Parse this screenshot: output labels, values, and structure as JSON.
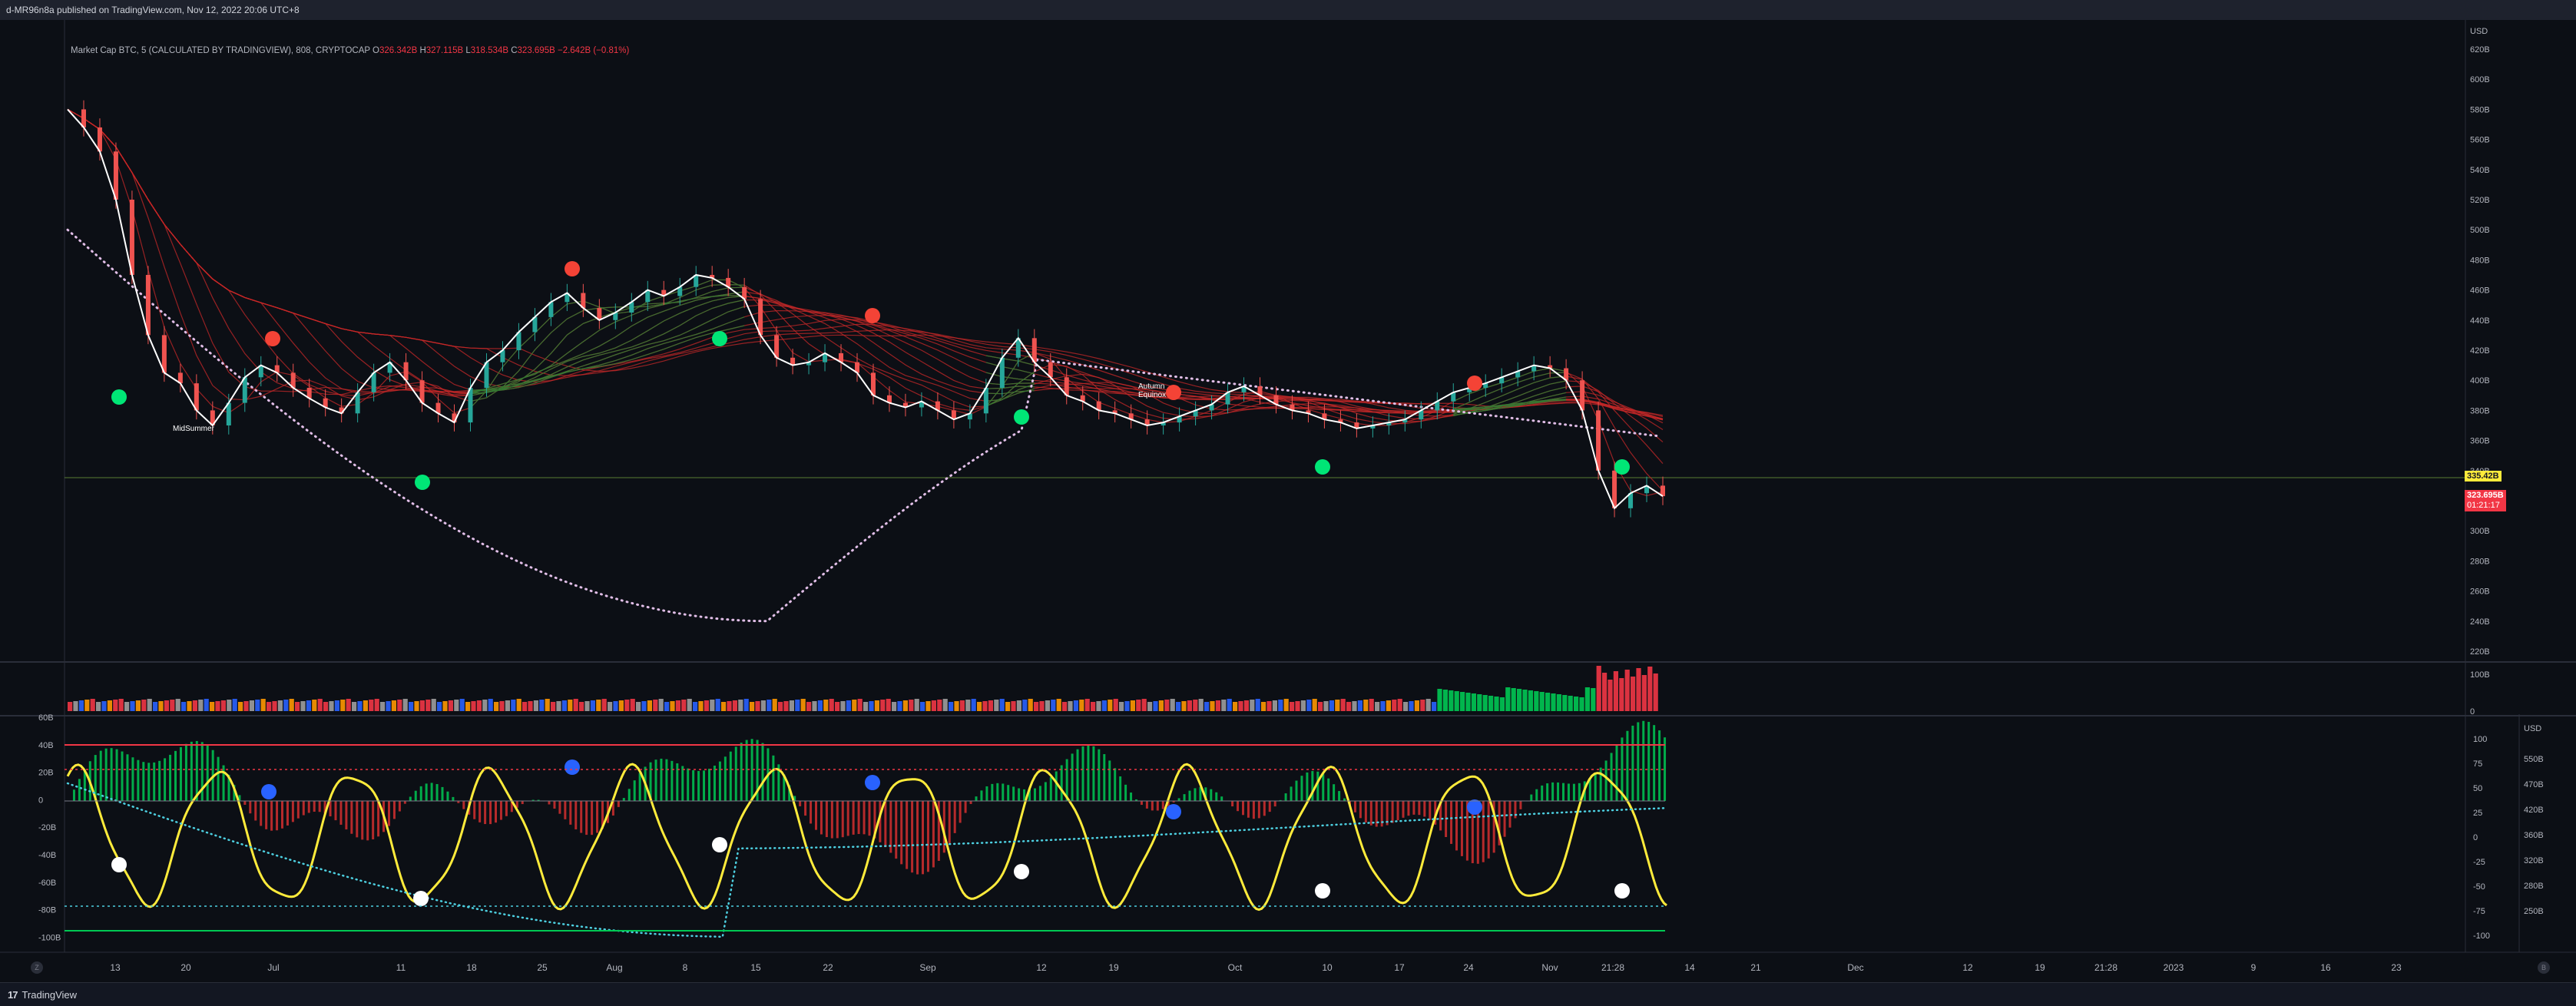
{
  "header": {
    "publish_text": "d-MR96n8a published on TradingView.com, Nov 12, 2022 20:06 UTC+8"
  },
  "legend": {
    "symbol": "Market Cap BTC, 5 (CALCULATED BY TRADINGVIEW), 808, CRYPTOCAP",
    "o_label": "O",
    "o_value": "326.342B",
    "h_label": "H",
    "h_value": "327.115B",
    "l_label": "L",
    "l_value": "318.534B",
    "c_label": "C",
    "c_value": "323.695B",
    "change": "−2.642B (−0.81%)"
  },
  "price_axis": {
    "currency": "USD",
    "ticks": [
      "620B",
      "600B",
      "580B",
      "560B",
      "540B",
      "520B",
      "500B",
      "480B",
      "460B",
      "440B",
      "420B",
      "400B",
      "380B",
      "360B",
      "340B",
      "300B",
      "280B",
      "260B",
      "240B",
      "220B"
    ],
    "hline_label": "335.42B",
    "last_price": "323.695B",
    "countdown": "01:21:17"
  },
  "volume_axis": {
    "ticks": [
      "100B",
      "0"
    ]
  },
  "osc_left_axis": {
    "ticks": [
      "60B",
      "40B",
      "20B",
      "0",
      "-20B",
      "-40B",
      "-60B",
      "-80B",
      "-100B"
    ]
  },
  "osc_right_axis": {
    "currency": "USD",
    "ticks_a": [
      "100",
      "75",
      "50",
      "25",
      "0",
      "-25",
      "-50",
      "-75",
      "-100"
    ],
    "ticks_b": [
      "550B",
      "470B",
      "420B",
      "360B",
      "320B",
      "280B",
      "250B"
    ]
  },
  "time_axis": {
    "labels": [
      "13",
      "20",
      "Jul",
      "11",
      "18",
      "25",
      "Aug",
      "8",
      "15",
      "22",
      "Sep",
      "12",
      "19",
      "Oct",
      "10",
      "17",
      "24",
      "Nov",
      "21:28",
      "14",
      "21",
      "Dec",
      "12",
      "19",
      "21:28",
      "2023",
      "9",
      "16",
      "23"
    ]
  },
  "annotations": {
    "midsummer": "MidSummer",
    "autumn": "Autumn",
    "equinox": "Equinox"
  },
  "nav": {
    "left": "Z",
    "right": "B"
  },
  "brand": {
    "logo": "17",
    "name": "TradingView"
  },
  "colors": {
    "bg": "#0c0f15",
    "up": "#00c853",
    "down": "#f23645",
    "yellow": "#ffeb3b",
    "pink_dots": "#e1bee7",
    "cyan_dots": "#4dd0e1",
    "blue_dot": "#2962ff"
  },
  "chart_data": {
    "type": "line",
    "title": "Market Cap BTC, 5 (CALCULATED BY TRADINGVIEW), 808, CRYPTOCAP",
    "ylabel": "USD",
    "ylim": [
      210,
      630
    ],
    "series": [
      {
        "values": [
          580,
          568,
          552,
          520,
          470,
          430,
          405,
          398,
          380,
          370,
          385,
          402,
          410,
          405,
          395,
          388,
          382,
          378,
          392,
          405,
          412,
          400,
          385,
          378,
          372,
          395,
          412,
          420,
          432,
          442,
          452,
          458,
          448,
          440,
          445,
          452,
          460,
          456,
          462,
          470,
          468,
          462,
          454,
          430,
          415,
          410,
          412,
          418,
          412,
          405,
          390,
          385,
          382,
          386,
          380,
          374,
          378,
          395,
          415,
          428,
          412,
          402,
          390,
          386,
          380,
          378,
          374,
          370,
          372,
          376,
          380,
          384,
          392,
          396,
          390,
          384,
          380,
          378,
          374,
          372,
          368,
          370,
          372,
          374,
          380,
          386,
          392,
          395,
          398,
          402,
          406,
          410,
          408,
          400,
          380,
          340,
          315,
          325,
          330,
          323
        ]
      }
    ]
  }
}
